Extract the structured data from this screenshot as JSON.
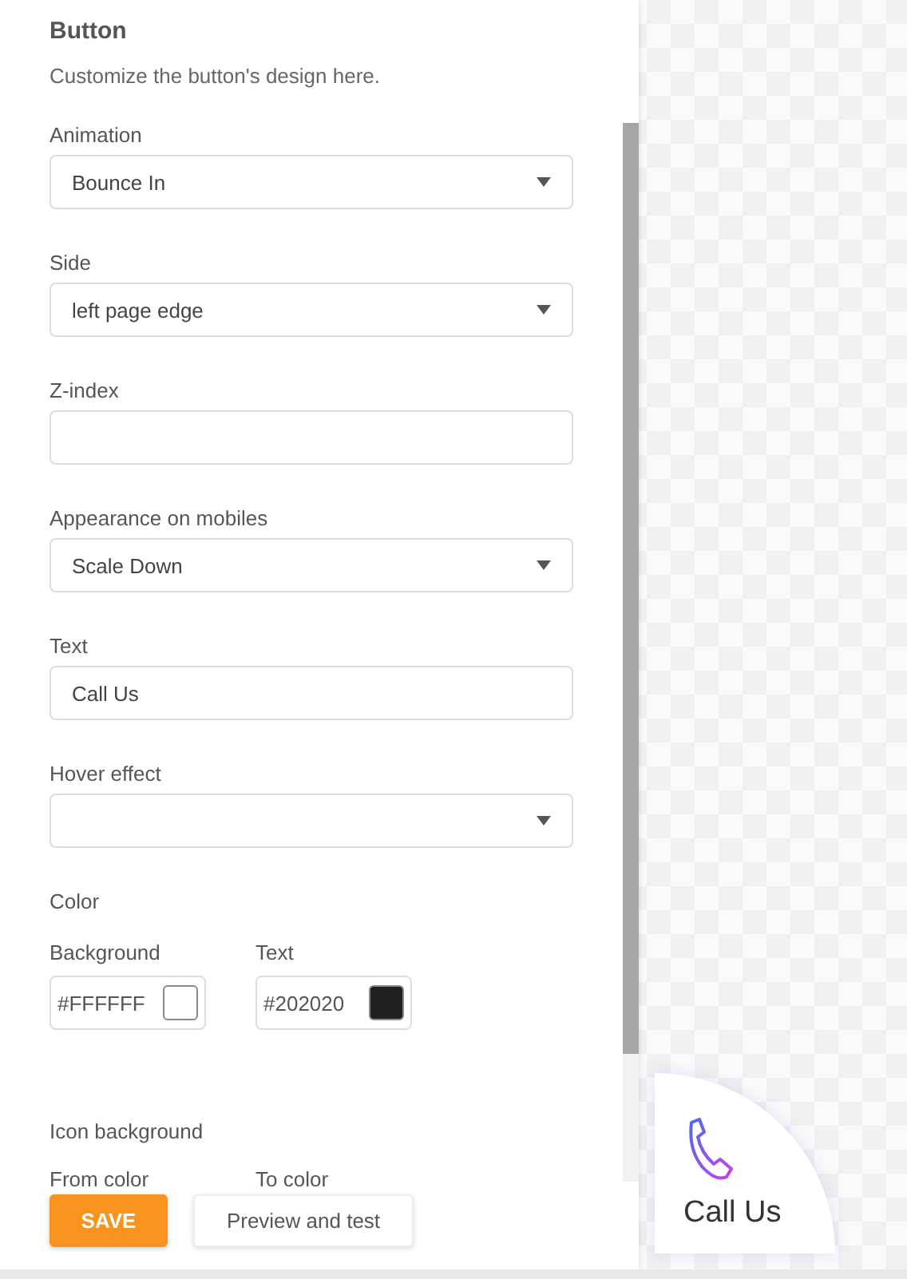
{
  "panel": {
    "title": "Button",
    "description": "Customize the button's design here."
  },
  "fields": [
    {
      "kind": "select",
      "label": "Animation",
      "value": "Bounce In"
    },
    {
      "kind": "select",
      "label": "Side",
      "value": "left page edge"
    },
    {
      "kind": "text",
      "label": "Z-index"
    },
    {
      "kind": "select",
      "label": "Appearance on mobiles",
      "value": "Scale Down"
    },
    {
      "kind": "text",
      "label": "Text",
      "value": "Call Us"
    },
    {
      "kind": "select",
      "label": "Hover effect"
    },
    {
      "kind": "colors",
      "label": "Color",
      "items": [
        {
          "label": "Background",
          "value": "#FFFFFF",
          "color": "#ffffff"
        },
        {
          "label": "Text",
          "value": "#202020",
          "color": "#202020"
        }
      ]
    },
    {
      "kind": "colors",
      "label": "Icon background",
      "items": [
        {
          "label": "From color"
        },
        {
          "label": "To color"
        }
      ]
    }
  ],
  "buttons": [
    {
      "kind": "primary",
      "label": "SAVE"
    },
    {
      "kind": "secondary",
      "label": "Preview and test"
    }
  ],
  "preview": {
    "label": "Call Us"
  }
}
